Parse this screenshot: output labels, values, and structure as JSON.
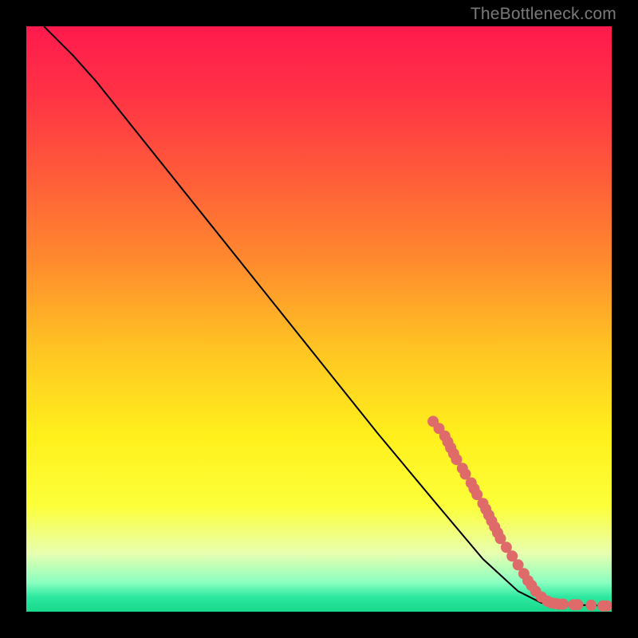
{
  "attribution": "TheBottleneck.com",
  "chart_data": {
    "type": "line",
    "title": "",
    "xlabel": "",
    "ylabel": "",
    "xlim": [
      0,
      100
    ],
    "ylim": [
      0,
      100
    ],
    "grid": false,
    "legend": false,
    "background_gradient": {
      "stops": [
        {
          "pos": 0.0,
          "color": "#ff1a4d"
        },
        {
          "pos": 0.12,
          "color": "#ff3345"
        },
        {
          "pos": 0.25,
          "color": "#ff5a3a"
        },
        {
          "pos": 0.4,
          "color": "#ff8a2e"
        },
        {
          "pos": 0.55,
          "color": "#ffc423"
        },
        {
          "pos": 0.7,
          "color": "#fff01c"
        },
        {
          "pos": 0.82,
          "color": "#fcff3a"
        },
        {
          "pos": 0.9,
          "color": "#e8ffb0"
        },
        {
          "pos": 0.95,
          "color": "#8affc0"
        },
        {
          "pos": 0.975,
          "color": "#2de8a0"
        },
        {
          "pos": 1.0,
          "color": "#17d98c"
        }
      ]
    },
    "curve": [
      {
        "x": 3.0,
        "y": 100.0
      },
      {
        "x": 5.0,
        "y": 98.0
      },
      {
        "x": 8.0,
        "y": 95.0
      },
      {
        "x": 12.0,
        "y": 90.5
      },
      {
        "x": 20.0,
        "y": 80.5
      },
      {
        "x": 30.0,
        "y": 68.0
      },
      {
        "x": 40.0,
        "y": 55.5
      },
      {
        "x": 50.0,
        "y": 43.0
      },
      {
        "x": 60.0,
        "y": 30.5
      },
      {
        "x": 70.0,
        "y": 18.5
      },
      {
        "x": 78.0,
        "y": 9.0
      },
      {
        "x": 84.0,
        "y": 3.5
      },
      {
        "x": 88.0,
        "y": 1.5
      },
      {
        "x": 92.0,
        "y": 1.2
      },
      {
        "x": 96.0,
        "y": 1.1
      },
      {
        "x": 100.0,
        "y": 1.0
      }
    ],
    "markers": [
      {
        "x": 69.5,
        "y": 32.5
      },
      {
        "x": 70.5,
        "y": 31.3
      },
      {
        "x": 71.5,
        "y": 30.0
      },
      {
        "x": 72.0,
        "y": 29.0
      },
      {
        "x": 72.5,
        "y": 28.0
      },
      {
        "x": 73.0,
        "y": 27.0
      },
      {
        "x": 73.5,
        "y": 26.0
      },
      {
        "x": 74.5,
        "y": 24.5
      },
      {
        "x": 75.0,
        "y": 23.5
      },
      {
        "x": 76.0,
        "y": 22.0
      },
      {
        "x": 76.5,
        "y": 21.0
      },
      {
        "x": 77.0,
        "y": 20.0
      },
      {
        "x": 78.0,
        "y": 18.5
      },
      {
        "x": 78.5,
        "y": 17.5
      },
      {
        "x": 79.0,
        "y": 16.5
      },
      {
        "x": 79.5,
        "y": 15.5
      },
      {
        "x": 80.0,
        "y": 14.5
      },
      {
        "x": 80.5,
        "y": 13.5
      },
      {
        "x": 81.0,
        "y": 12.5
      },
      {
        "x": 82.0,
        "y": 11.0
      },
      {
        "x": 83.0,
        "y": 9.5
      },
      {
        "x": 84.0,
        "y": 8.0
      },
      {
        "x": 85.0,
        "y": 6.5
      },
      {
        "x": 85.7,
        "y": 5.3
      },
      {
        "x": 86.3,
        "y": 4.5
      },
      {
        "x": 87.0,
        "y": 3.5
      },
      {
        "x": 88.0,
        "y": 2.5
      },
      {
        "x": 89.0,
        "y": 1.8
      },
      {
        "x": 89.7,
        "y": 1.5
      },
      {
        "x": 90.3,
        "y": 1.4
      },
      {
        "x": 91.0,
        "y": 1.3
      },
      {
        "x": 91.7,
        "y": 1.3
      },
      {
        "x": 93.5,
        "y": 1.2
      },
      {
        "x": 94.2,
        "y": 1.2
      },
      {
        "x": 96.5,
        "y": 1.1
      },
      {
        "x": 98.5,
        "y": 1.0
      },
      {
        "x": 99.2,
        "y": 1.0
      }
    ],
    "marker_style": {
      "color": "#df6a6a",
      "radius_px": 7
    }
  }
}
